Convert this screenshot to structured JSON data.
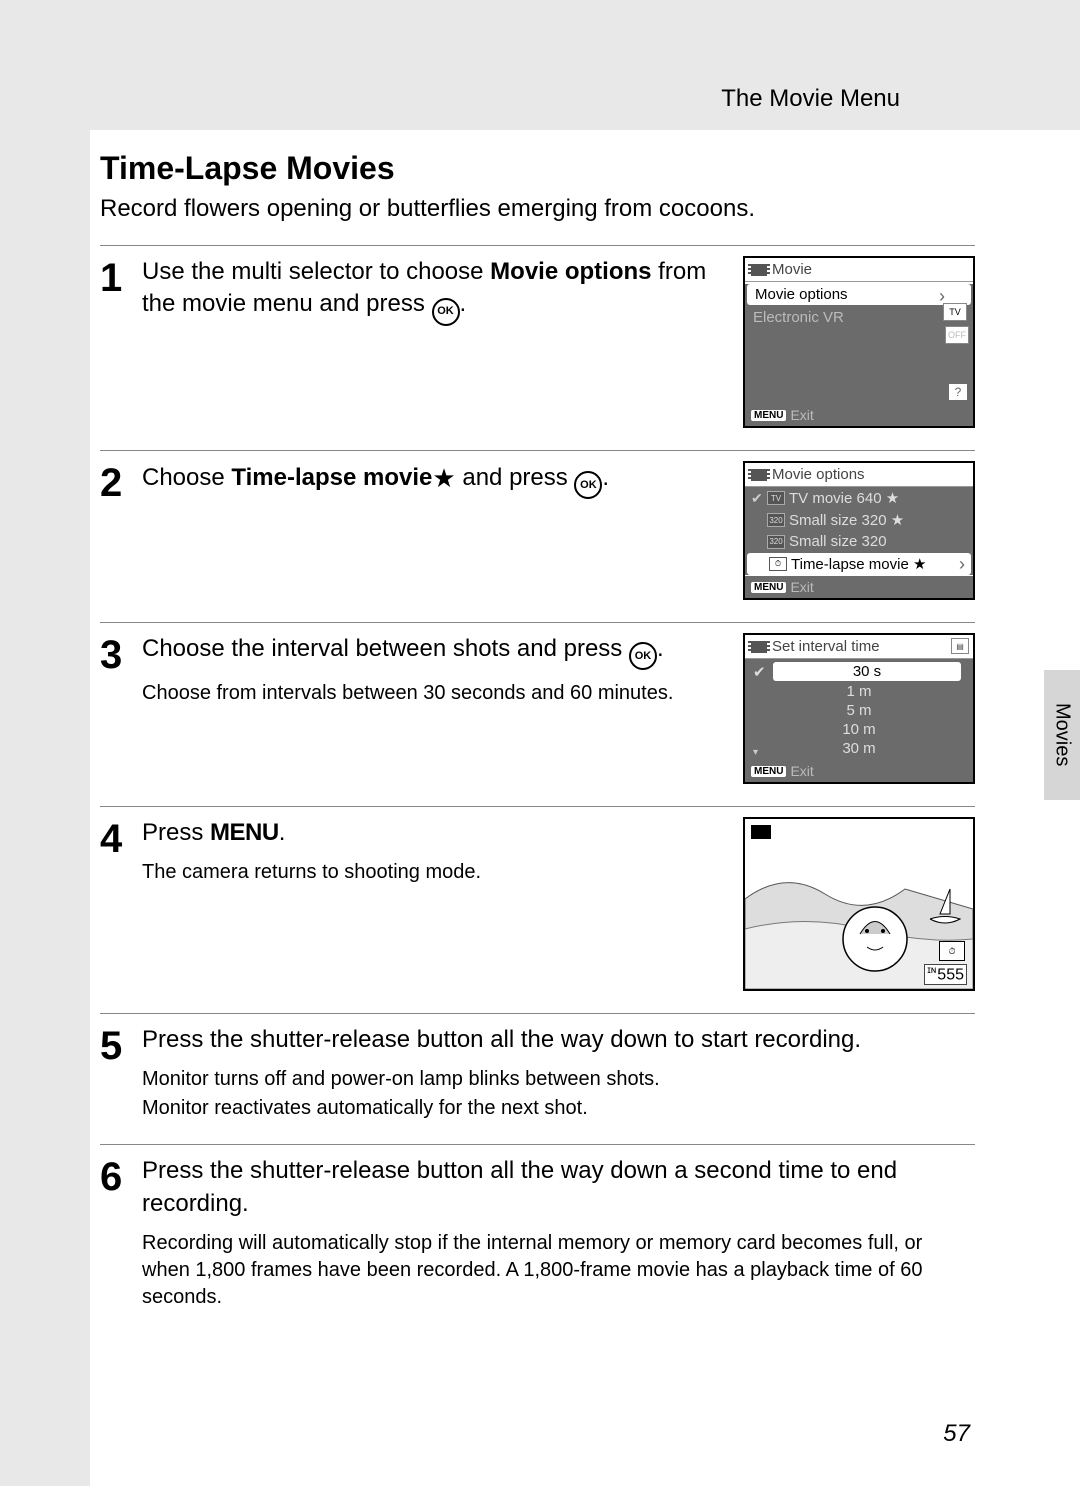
{
  "header": {
    "section": "The Movie Menu"
  },
  "title": "Time-Lapse Movies",
  "intro": "Record flowers opening or butterflies emerging from cocoons.",
  "side_tab": "Movies",
  "page_number": "57",
  "steps": {
    "s1": {
      "num": "1",
      "text_a": "Use the multi selector to choose ",
      "text_b": "Movie options",
      "text_c": " from the movie menu and press ",
      "screen": {
        "title": "Movie",
        "row1": "Movie options",
        "row1_badge": "TV",
        "row2": "Electronic VR",
        "row2_badge": "OFF",
        "exit": "Exit"
      }
    },
    "s2": {
      "num": "2",
      "text_a": "Choose ",
      "text_b": "Time-lapse movie",
      "text_c": " and press ",
      "screen": {
        "title": "Movie options",
        "r1": "TV movie 640 ★",
        "r2": "Small size 320 ★",
        "r3": "Small size 320",
        "r4": "Time-lapse movie ★",
        "exit": "Exit"
      }
    },
    "s3": {
      "num": "3",
      "text_a": "Choose the interval between shots and press ",
      "sub": "Choose from intervals between 30 seconds and 60 minutes.",
      "screen": {
        "title": "Set interval time",
        "r1": "30 s",
        "r2": "1 m",
        "r3": "5 m",
        "r4": "10 m",
        "r5": "30 m",
        "exit": "Exit"
      }
    },
    "s4": {
      "num": "4",
      "text_a": "Press ",
      "text_b": "MENU",
      "text_c": ".",
      "sub": "The camera returns to shooting mode.",
      "count": "555"
    },
    "s5": {
      "num": "5",
      "text": "Press the shutter-release button all the way down to start recording.",
      "sub1": "Monitor turns off and power-on lamp blinks between shots.",
      "sub2": "Monitor reactivates automatically for the next shot."
    },
    "s6": {
      "num": "6",
      "text": "Press the shutter-release button all the way down a second time to end recording.",
      "sub": "Recording will automatically stop if the internal memory or memory card becomes full, or when 1,800 frames have been recorded. A 1,800-frame movie has a playback time of 60 seconds."
    }
  },
  "labels": {
    "menu_chip": "MENU",
    "ok": "OK",
    "help": "?"
  }
}
